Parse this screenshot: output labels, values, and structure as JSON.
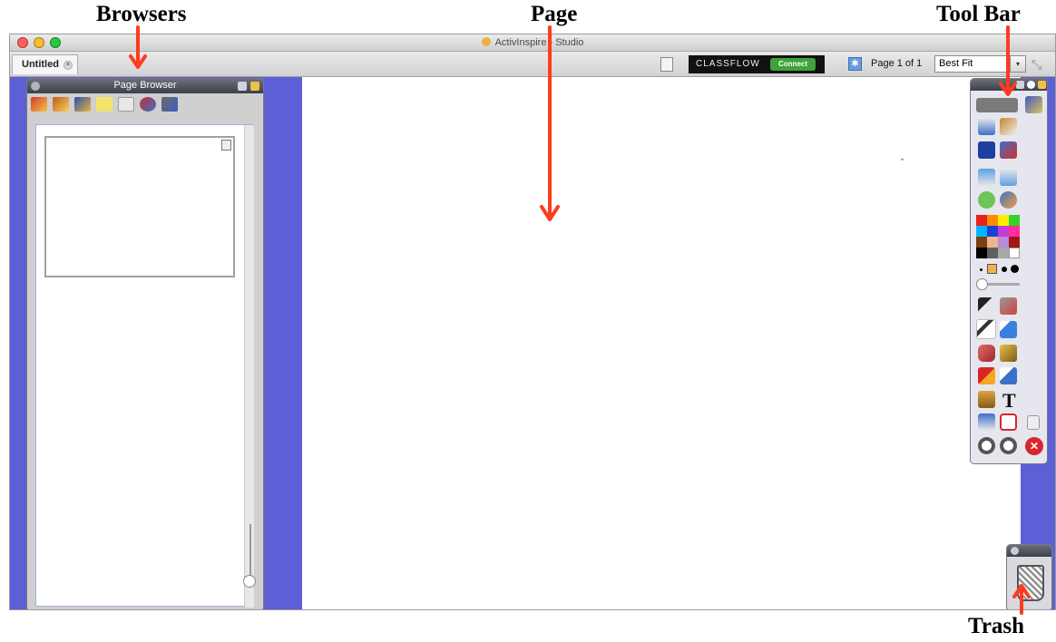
{
  "annotations": {
    "browsers": "Browsers",
    "page": "Page",
    "toolbar": "Tool Bar",
    "trash": "Trash"
  },
  "window": {
    "title": "ActivInspire - Studio",
    "tab_label": "Untitled",
    "tab_close_icon": "×"
  },
  "toolbar": {
    "classflow_label": "CLASSFLOW",
    "connect_label": "Connect",
    "page_count": "Page 1 of 1",
    "zoom": "Best Fit",
    "zoom_arrow": "▾",
    "fullscreen_icon": "⤡"
  },
  "page_browser": {
    "title": "Page Browser",
    "icons": [
      "page-sorter-icon",
      "resource-library-icon",
      "object-browser-icon",
      "notes-icon",
      "property-icon",
      "actions-icon",
      "voting-icon"
    ]
  },
  "toolbox": {
    "text_tool_label": "T",
    "exit_label": "✕"
  },
  "colors": {
    "canvas_background": "#5c5fd6",
    "page": "#ffffff",
    "arrow": "#ff3b1f",
    "palette": [
      "#e8211c",
      "#ff8c00",
      "#ffee00",
      "#35d12b",
      "#00b4ff",
      "#1d3fd8",
      "#c23dd6",
      "#ff2e9a",
      "#7a3f12",
      "#e9b88f",
      "#b98ad6",
      "#a01515",
      "#000000",
      "#606060",
      "#a8a8a8",
      "#ffffff"
    ]
  }
}
